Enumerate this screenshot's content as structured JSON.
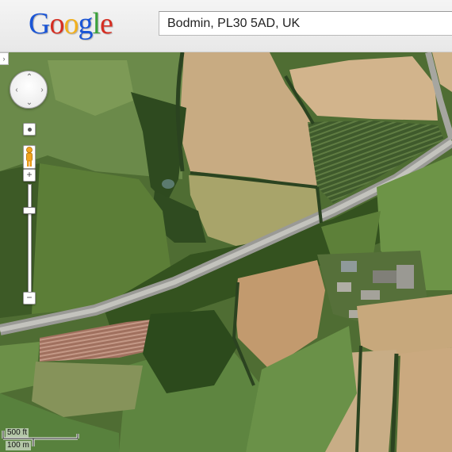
{
  "header": {
    "logo_letters": [
      {
        "ch": "G",
        "color": "#1a55d6"
      },
      {
        "ch": "o",
        "color": "#d62e22"
      },
      {
        "ch": "o",
        "color": "#f2b01e"
      },
      {
        "ch": "g",
        "color": "#1a55d6"
      },
      {
        "ch": "l",
        "color": "#3aa13a"
      },
      {
        "ch": "e",
        "color": "#d62e22"
      }
    ],
    "search_value": "Bodmin, PL30 5AD, UK"
  },
  "map": {
    "view": "satellite",
    "icons": {
      "pan": "pan-control-icon",
      "street_view": "pegman-icon",
      "zoom_in": "zoom-in-icon",
      "zoom_out": "zoom-out-icon"
    },
    "zoom_in_label": "+",
    "zoom_out_label": "−",
    "sidebar_toggle_label": "›",
    "scale": {
      "imperial": "500 ft",
      "metric": "100 m"
    }
  }
}
